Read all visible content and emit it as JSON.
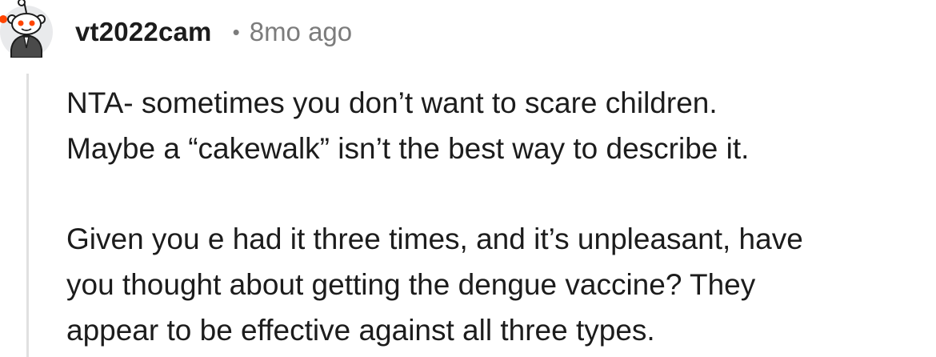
{
  "comment": {
    "username": "vt2022cam",
    "separator": "•",
    "timestamp": "8mo ago",
    "avatar_icon": "reddit-snoo-avatar-icon",
    "paragraphs": [
      [
        "NTA- sometimes you don’t want to scare children.",
        "Maybe a “cakewalk” isn’t the best way to describe it."
      ],
      [
        "Given you e had it three times, and it’s unpleasant, have",
        "you thought about getting the dengue vaccine? They",
        "appear to be effective against all three types."
      ]
    ]
  },
  "colors": {
    "text": "#1c1c1c",
    "meta": "#7c7c7c",
    "thread_line": "#e0e0e0",
    "snoo_accent": "#ff4500"
  }
}
